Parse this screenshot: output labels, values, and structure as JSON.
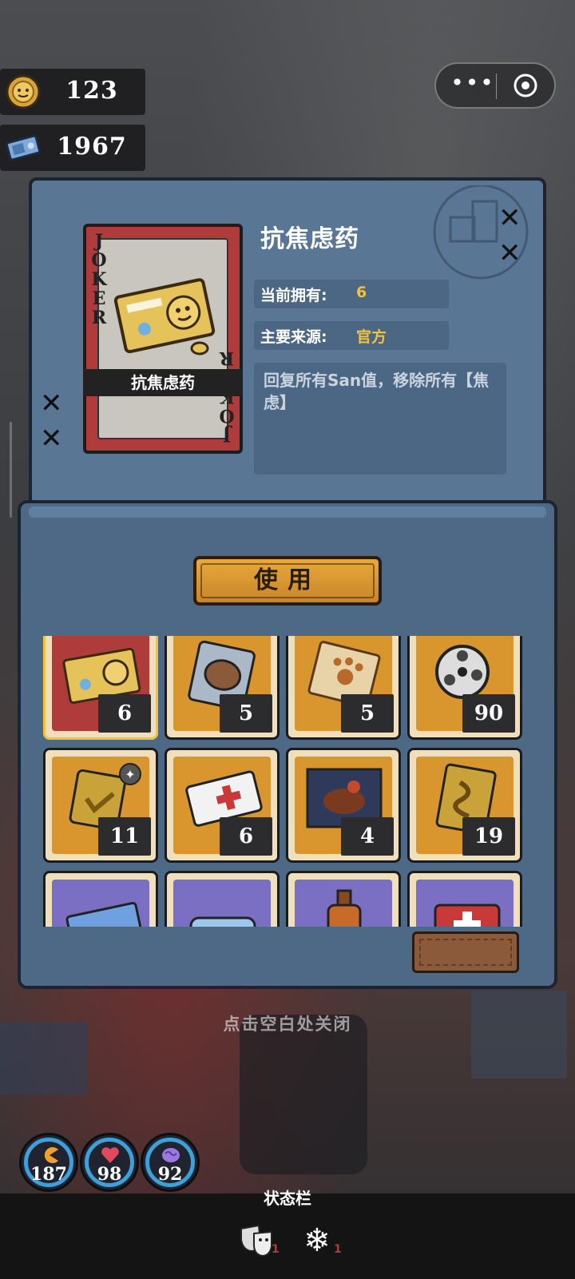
{
  "currencies": [
    {
      "name": "coin",
      "value": "123"
    },
    {
      "name": "ticket",
      "value": "1967"
    }
  ],
  "miniprogram_capsule": {
    "more_icon": "more-dots-icon",
    "close_icon": "target-close-icon"
  },
  "detail": {
    "card_joker_text": "JOKER",
    "card_label": "抗焦虑药",
    "title": "抗焦虑药",
    "owned_label": "当前拥有:",
    "owned_value": "6",
    "source_label": "主要来源:",
    "source_value": "官方",
    "description": "回复所有San值，移除所有【焦虑】"
  },
  "use_button": "使用",
  "inventory": [
    {
      "count": "6",
      "bg": "#b03b3b",
      "icon": "pill-card-icon",
      "selected": true
    },
    {
      "count": "5",
      "bg": "#d9962f",
      "icon": "capybara-bag-icon"
    },
    {
      "count": "5",
      "bg": "#d9962f",
      "icon": "paw-map-icon"
    },
    {
      "count": "90",
      "bg": "#d9962f",
      "icon": "film-reel-icon"
    },
    {
      "count": "11",
      "bg": "#d9962f",
      "icon": "gold-badge-icon"
    },
    {
      "count": "6",
      "bg": "#d9962f",
      "icon": "medical-card-icon"
    },
    {
      "count": "4",
      "bg": "#d9962f",
      "icon": "steak-poster-icon"
    },
    {
      "count": "19",
      "bg": "#d9962f",
      "icon": "gold-ribbon-card-icon"
    },
    {
      "count": "",
      "bg": "#7b6fc4",
      "icon": "blue-ticket-icon"
    },
    {
      "count": "",
      "bg": "#7b6fc4",
      "icon": "ice-pack-icon"
    },
    {
      "count": "",
      "bg": "#7b6fc4",
      "icon": "bottle-icon"
    },
    {
      "count": "",
      "bg": "#7b6fc4",
      "icon": "first-aid-kit-icon"
    }
  ],
  "close_hint": "点击空白处关闭",
  "stats": [
    {
      "name": "hunger",
      "value": "187",
      "icon": "pacman-icon"
    },
    {
      "name": "health",
      "value": "98",
      "icon": "heart-icon"
    },
    {
      "name": "sanity",
      "value": "92",
      "icon": "brain-icon"
    }
  ],
  "status_bar": {
    "title": "状态栏",
    "effects": [
      {
        "icon": "theater-masks-icon",
        "count": "1"
      },
      {
        "icon": "snowflake-icon",
        "count": "1"
      }
    ]
  }
}
